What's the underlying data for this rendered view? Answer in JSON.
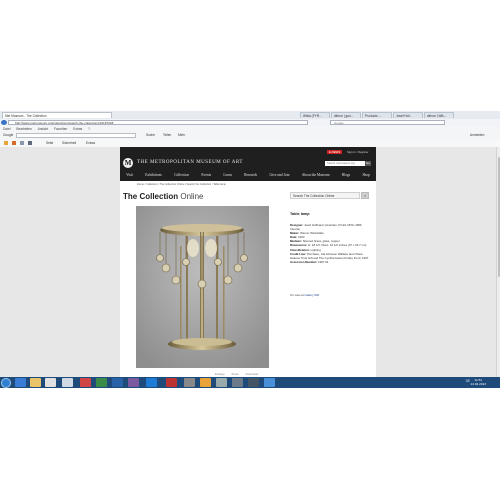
{
  "browser": {
    "tabs": [
      {
        "label": "Met Museum - The Collection",
        "active": true
      },
      {
        "label": "Wikia (FYR...",
        "active": false
      },
      {
        "label": "dirirue | goo...",
        "active": false
      },
      {
        "label": "Products ...",
        "active": false
      },
      {
        "label": "Josef Hof...",
        "active": false
      },
      {
        "label": "dirirue | Wik...",
        "active": false
      }
    ],
    "url": "http://www.metmuseum.org/collections/search-the-collections/10187028",
    "search_placeholder": "Google",
    "menu": [
      "Datei",
      "Bearbeiten",
      "Ansicht",
      "Favoriten",
      "Extras",
      "?"
    ],
    "google_label": "Google",
    "google_actions": [
      "Suche",
      "Teilen",
      "Mehr"
    ],
    "anmelden": "Anmelden",
    "commands": [
      "Seite",
      "Sicherheit",
      "Extras"
    ]
  },
  "site": {
    "logo_letter": "M",
    "title": "THE METROPOLITAN MUSEUM OF ART",
    "util_label": "E-NEWS",
    "util_action": "Sign In / Register",
    "search_placeholder": "Search metmuseum.org",
    "search_btn": "Go",
    "nav": [
      "Visit",
      "Exhibitions",
      "Collection",
      "Events",
      "Learn",
      "Research",
      "Give and Join",
      "About the Museum",
      "Blogs",
      "Shop"
    ],
    "breadcrumb": "Home / Collection / The Collection Online / Search the Collection / Table lamp",
    "heading_bold": "The Collection",
    "heading_light": "Online",
    "collection_search": "Search The Collection Online",
    "collection_search_btn": ">"
  },
  "object": {
    "title": "Table lamp",
    "details": [
      {
        "label": "Designer:",
        "value": "Josef Hoffmann (Austrian, Pirnitz 1870–1956 Vienna)"
      },
      {
        "label": "Maker:",
        "value": "Wiener Werkstätte"
      },
      {
        "label": "Date:",
        "value": "1903"
      },
      {
        "label": "Medium:",
        "value": "Silvered brass, glass, copper"
      },
      {
        "label": "Dimensions:",
        "value": "H. 18 1/2, Diam. 10 1/2 inches (47 x 26.7 cm)"
      },
      {
        "label": "Classification:",
        "value": "Lighting"
      },
      {
        "label": "Credit Line:",
        "value": "Purchase, Lila Acheson Wallace and Ohara Hakone Trust Gift and The Cynthia Hazen Polsky Fund, 1997"
      },
      {
        "label": "Accession Number:",
        "value": "1997.64"
      }
    ],
    "gallery_prefix": "On view at",
    "gallery_link": "Gallery 900",
    "photo_actions": [
      "Enlarge",
      "Share",
      "Download"
    ]
  },
  "taskbar": {
    "time": "11:51",
    "date": "14.04.2013",
    "lang": "DE"
  }
}
